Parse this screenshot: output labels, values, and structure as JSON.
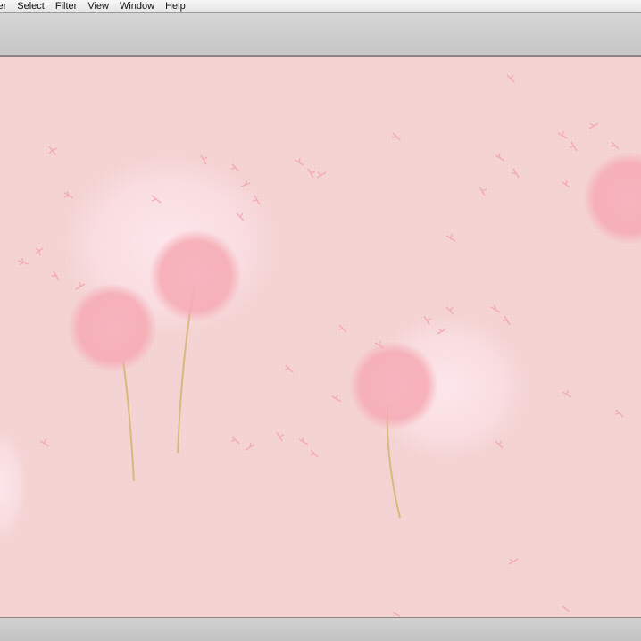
{
  "menubar": {
    "items": [
      "yer",
      "Select",
      "Filter",
      "View",
      "Window",
      "Help"
    ]
  },
  "canvas": {
    "background_color": "#f4d3d3",
    "dandelion_color": "#f6a9b3",
    "glow_color": "#fbe1e6",
    "stem_color": "#d9b97a",
    "artwork": "dandelion-wallpaper"
  }
}
